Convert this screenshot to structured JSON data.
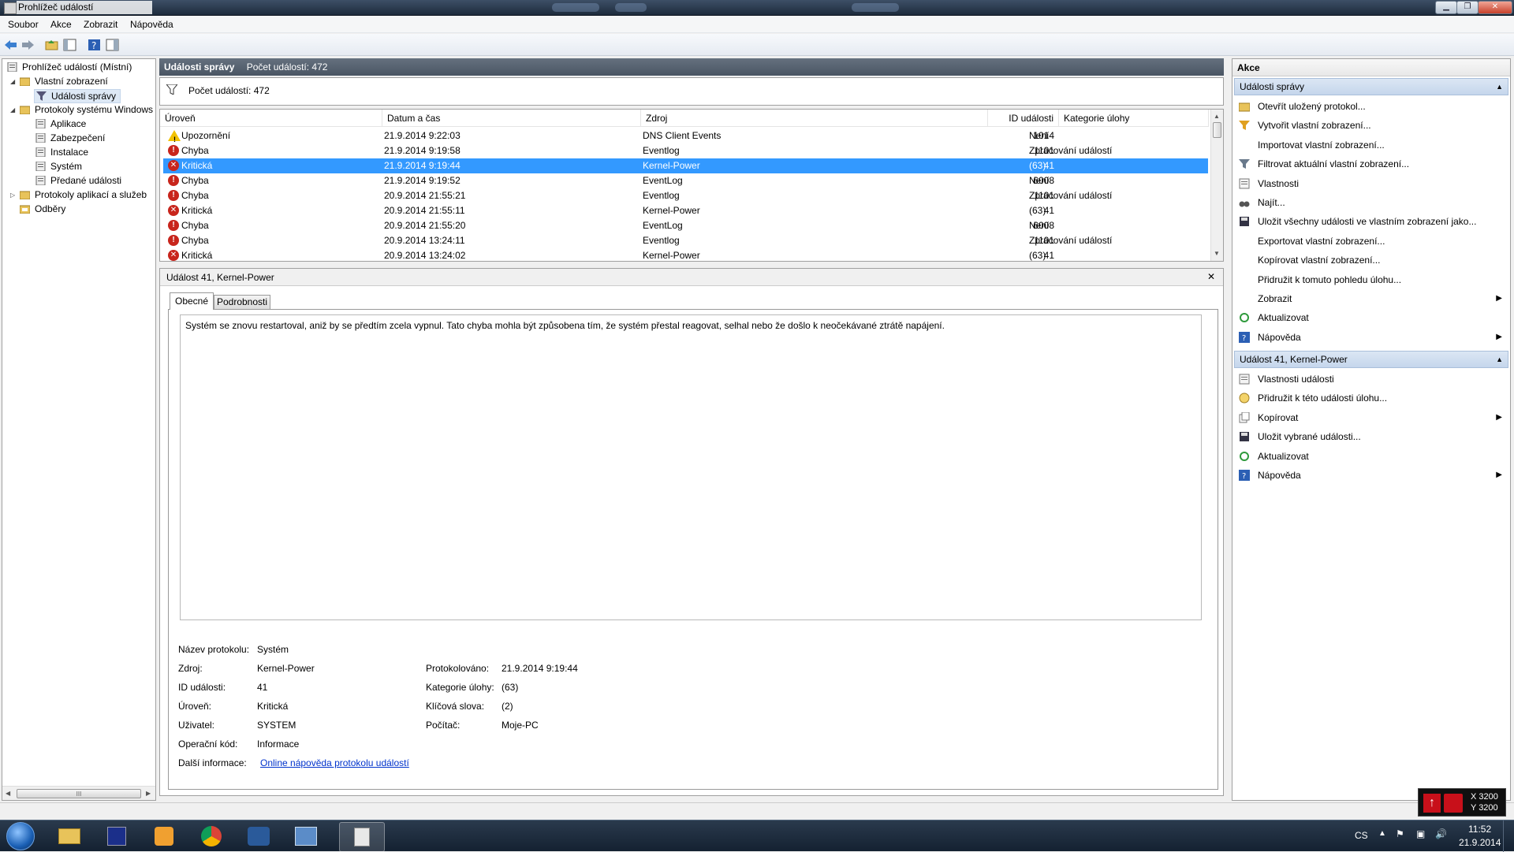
{
  "window": {
    "title": "Prohlížeč událostí"
  },
  "menu": [
    "Soubor",
    "Akce",
    "Zobrazit",
    "Nápověda"
  ],
  "tree": {
    "root": "Prohlížeč událostí (Místní)",
    "custom_views": "Vlastní zobrazení",
    "admin_events": "Události správy",
    "windows_logs": "Protokoly systému Windows",
    "logs": [
      "Aplikace",
      "Zabezpečení",
      "Instalace",
      "Systém",
      "Předané události"
    ],
    "app_logs": "Protokoly aplikací a služeb",
    "subscriptions": "Odběry",
    "scroll_grip": "III"
  },
  "center": {
    "header_title": "Události správy",
    "header_count": "Počet událostí: 472",
    "filter_text": "Počet událostí: 472",
    "columns": [
      "Úroveň",
      "Datum a čas",
      "Zdroj",
      "ID události",
      "Kategorie úlohy"
    ],
    "rows": [
      {
        "level": "Upozornění",
        "date": "21.9.2014 9:22:03",
        "source": "DNS Client Events",
        "id": "1014",
        "category": "Není",
        "type": "warn"
      },
      {
        "level": "Chyba",
        "date": "21.9.2014 9:19:58",
        "source": "Eventlog",
        "id": "1101",
        "category": "Zpracování událostí",
        "type": "err"
      },
      {
        "level": "Kritická",
        "date": "21.9.2014 9:19:44",
        "source": "Kernel-Power",
        "id": "41",
        "category": "(63)",
        "type": "crit"
      },
      {
        "level": "Chyba",
        "date": "21.9.2014 9:19:52",
        "source": "EventLog",
        "id": "6008",
        "category": "Není",
        "type": "err"
      },
      {
        "level": "Chyba",
        "date": "20.9.2014 21:55:21",
        "source": "Eventlog",
        "id": "1101",
        "category": "Zpracování událostí",
        "type": "err"
      },
      {
        "level": "Kritická",
        "date": "20.9.2014 21:55:11",
        "source": "Kernel-Power",
        "id": "41",
        "category": "(63)",
        "type": "crit"
      },
      {
        "level": "Chyba",
        "date": "20.9.2014 21:55:20",
        "source": "EventLog",
        "id": "6008",
        "category": "Není",
        "type": "err"
      },
      {
        "level": "Chyba",
        "date": "20.9.2014 13:24:11",
        "source": "Eventlog",
        "id": "1101",
        "category": "Zpracování událostí",
        "type": "err"
      },
      {
        "level": "Kritická",
        "date": "20.9.2014 13:24:02",
        "source": "Kernel-Power",
        "id": "41",
        "category": "(63)",
        "type": "crit"
      }
    ],
    "selected_row": 2
  },
  "detail": {
    "title": "Událost 41, Kernel-Power",
    "close": "✕",
    "tabs": [
      "Obecné",
      "Podrobnosti"
    ],
    "description": "Systém se znovu restartoval, aniž by se předtím zcela vypnul. Tato chyba mohla být způsobena tím, že systém přestal reagovat, selhal nebo že došlo k neočekávané ztrátě napájení.",
    "labels": {
      "log_name": "Název protokolu:",
      "source": "Zdroj:",
      "event_id": "ID události:",
      "level": "Úroveň:",
      "user": "Uživatel:",
      "opcode": "Operační kód:",
      "more_info": "Další informace:",
      "logged": "Protokolováno:",
      "task_category": "Kategorie úlohy:",
      "keywords": "Klíčová slova:",
      "computer": "Počítač:"
    },
    "values": {
      "log_name": "Systém",
      "source": "Kernel-Power",
      "event_id": "41",
      "level": "Kritická",
      "user": "SYSTEM",
      "opcode": "Informace",
      "more_info_link": "Online nápověda protokolu událostí",
      "logged": "21.9.2014 9:19:44",
      "task_category": "(63)",
      "keywords": "(2)",
      "computer": "Moje-PC"
    }
  },
  "actions": {
    "title": "Akce",
    "section1": "Události správy",
    "section1_items": [
      {
        "label": "Otevřít uložený protokol...",
        "icon": "open-folder-icon",
        "arrow": false
      },
      {
        "label": "Vytvořit vlastní zobrazení...",
        "icon": "filter-new-icon",
        "arrow": false
      },
      {
        "label": "Importovat vlastní zobrazení...",
        "icon": "",
        "arrow": false
      },
      {
        "label": "Filtrovat aktuální vlastní zobrazení...",
        "icon": "filter-icon",
        "arrow": false
      },
      {
        "label": "Vlastnosti",
        "icon": "properties-icon",
        "arrow": false
      },
      {
        "label": "Najít...",
        "icon": "binoculars-icon",
        "arrow": false
      },
      {
        "label": "Uložit všechny události ve vlastním zobrazení jako...",
        "icon": "save-icon",
        "arrow": false
      },
      {
        "label": "Exportovat vlastní zobrazení...",
        "icon": "",
        "arrow": false
      },
      {
        "label": "Kopírovat vlastní zobrazení...",
        "icon": "",
        "arrow": false
      },
      {
        "label": "Přidružit k tomuto pohledu úlohu...",
        "icon": "",
        "arrow": false
      },
      {
        "label": "Zobrazit",
        "icon": "",
        "arrow": true
      },
      {
        "label": "Aktualizovat",
        "icon": "refresh-icon",
        "arrow": false
      },
      {
        "label": "Nápověda",
        "icon": "help-icon",
        "arrow": true
      }
    ],
    "section2": "Událost 41, Kernel-Power",
    "section2_items": [
      {
        "label": "Vlastnosti události",
        "icon": "properties-icon",
        "arrow": false
      },
      {
        "label": "Přidružit k této události úlohu...",
        "icon": "task-icon",
        "arrow": false
      },
      {
        "label": "Kopírovat",
        "icon": "copy-icon",
        "arrow": true
      },
      {
        "label": "Uložit vybrané události...",
        "icon": "save-icon",
        "arrow": false
      },
      {
        "label": "Aktualizovat",
        "icon": "refresh-icon",
        "arrow": false
      },
      {
        "label": "Nápověda",
        "icon": "help-icon",
        "arrow": true
      }
    ]
  },
  "overlay": {
    "x": "X 3200",
    "y": "Y 3200"
  },
  "tray": {
    "lang": "CS",
    "time": "11:52",
    "date": "21.9.2014"
  }
}
